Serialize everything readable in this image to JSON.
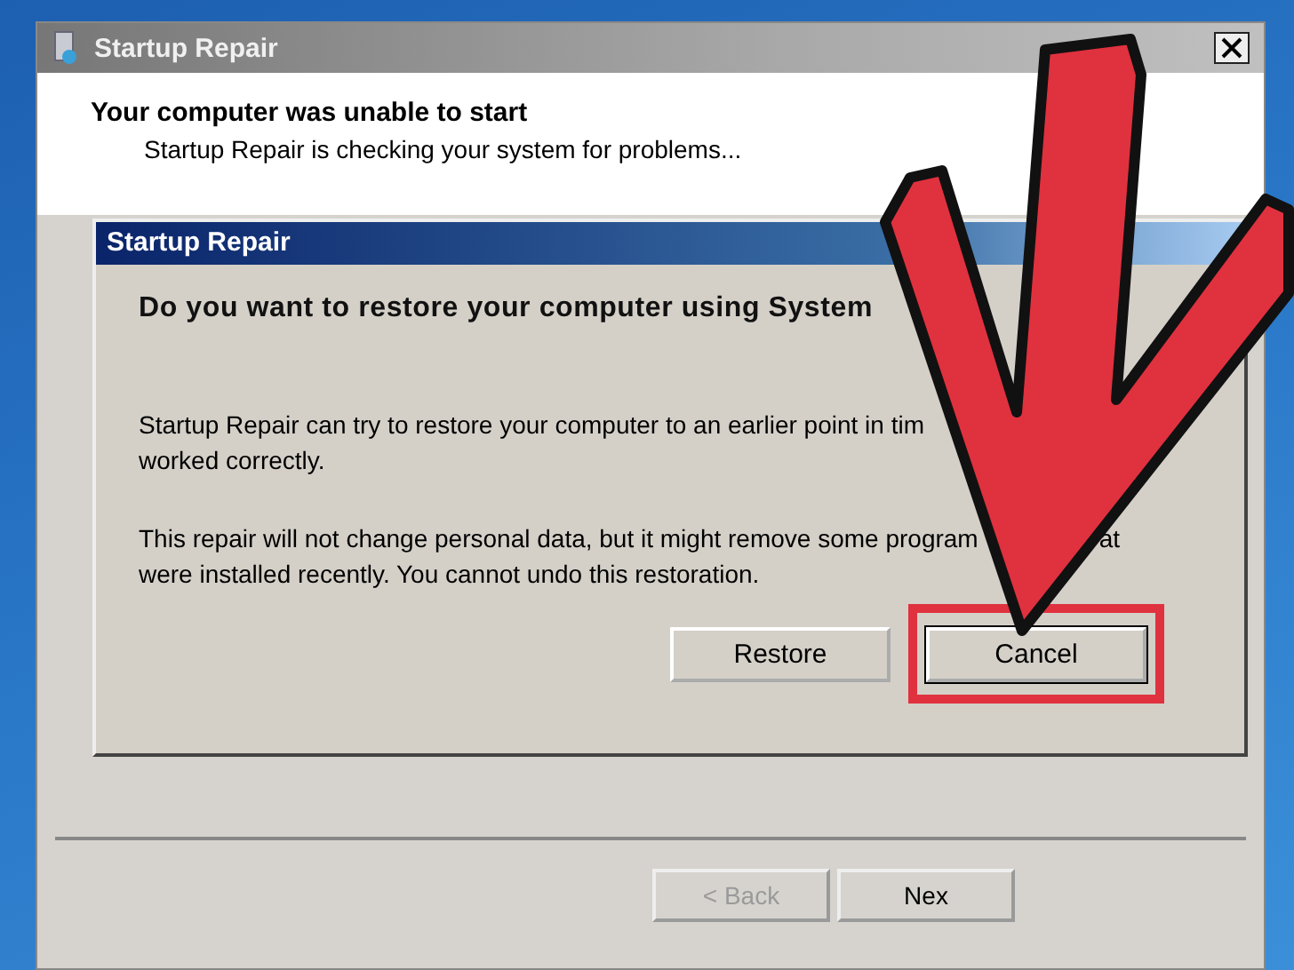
{
  "main_window": {
    "title": "Startup Repair",
    "heading": "Your computer was unable to start",
    "subtitle": "Startup Repair is checking your system for problems...",
    "buttons": [
      {
        "label": "< Back",
        "disabled": true
      },
      {
        "label": "Nex",
        "disabled": false
      }
    ]
  },
  "dialog": {
    "title": "Startup Repair",
    "question": "Do you want to restore your computer using System",
    "paragraphs": [
      {
        "lines": [
          {
            "segments": [
              "Startup Repair can try to restore your computer to an earlier point in tim"
            ]
          },
          {
            "segments": [
              "worked correctly."
            ]
          }
        ]
      },
      {
        "lines": [
          {
            "segments": [
              "This repair will not change personal data, but it might remove some program",
              "at"
            ]
          },
          {
            "segments": [
              "were installed recently. You cannot undo this restoration."
            ]
          }
        ]
      }
    ],
    "buttons": [
      {
        "label": "Restore",
        "highlighted": false
      },
      {
        "label": "Cancel",
        "highlighted": true
      }
    ]
  }
}
